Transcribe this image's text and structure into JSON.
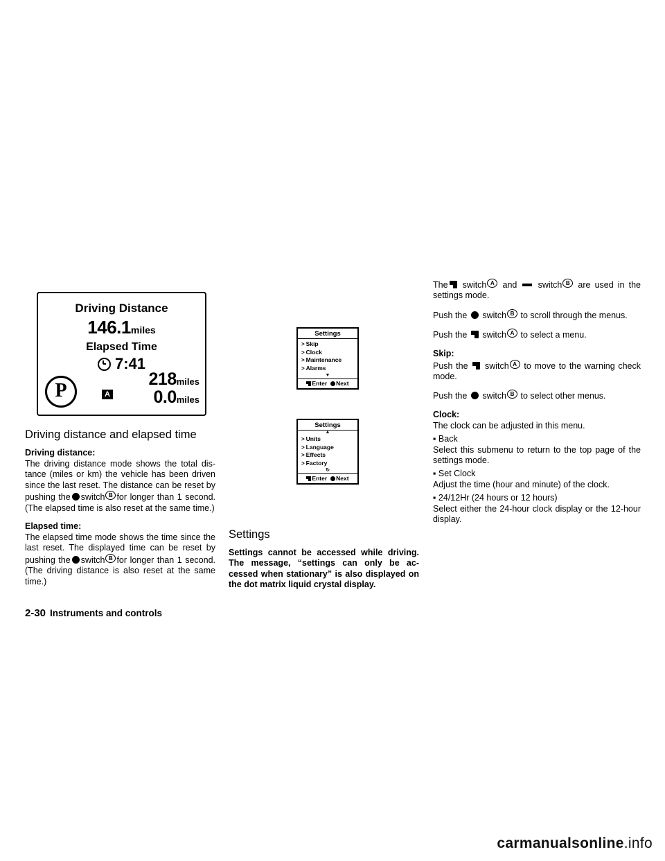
{
  "figure_lcd": {
    "title": "Driving Distance",
    "distance_value": "146.1",
    "distance_unit": "miles",
    "elapsed_label": "Elapsed Time",
    "elapsed_value": "7:41",
    "gear": "P",
    "trip_badge": "A",
    "odometer_value": "218",
    "odometer_unit": "miles",
    "trip_value": "0.0",
    "trip_unit": "miles"
  },
  "col1": {
    "heading": "Driving distance and elapsed time",
    "driving_label": "Driving distance:",
    "driving_text_1": "The driving distance mode shows the total dis-tance (miles or km) the vehicle has been driven since the last reset. The distance can be reset by pushing the",
    "driving_text_2": "switch",
    "driving_text_3": "for longer than 1 second. (The elapsed time is also reset at the same time.)",
    "elapsed_label": "Elapsed time:",
    "elapsed_text_1": "The elapsed time mode shows the time since the last reset. The displayed time can be reset by pushing the",
    "elapsed_text_2": "switch",
    "elapsed_text_3": "for longer than 1 second. (The driving distance is also reset at the same time.)",
    "switch_b": "B"
  },
  "menu1": {
    "title": "Settings",
    "items": [
      "Skip",
      "Clock",
      "Maintenance",
      "Alarms"
    ],
    "enter_label": "Enter",
    "next_label": "Next"
  },
  "menu2": {
    "title": "Settings",
    "items": [
      "Units",
      "Language",
      "Effects",
      "Factory"
    ],
    "enter_label": "Enter",
    "next_label": "Next"
  },
  "col2": {
    "heading": "Settings",
    "warning": "Settings cannot be accessed while driving. The message, “settings can only be ac-cessed when stationary” is also displayed on the dot matrix liquid crystal display."
  },
  "col3": {
    "p1_a": "The",
    "p1_b": "switch",
    "p1_c": "and",
    "p1_d": "switch",
    "p1_e": "are used in the settings mode.",
    "p2_a": "Push the",
    "p2_b": "switch",
    "p2_c": "to scroll through the menus.",
    "p3_a": "Push the",
    "p3_b": "switch",
    "p3_c": "to select a menu.",
    "skip_label": "Skip:",
    "p4_a": "Push the",
    "p4_b": "switch",
    "p4_c": "to move to the warning check mode.",
    "p5_a": "Push the",
    "p5_b": "switch",
    "p5_c": "to select other menus.",
    "clock_label": "Clock:",
    "p6": "The clock can be adjusted in this menu.",
    "bullet1": "Back",
    "bullet1_text": "Select this submenu to return to the top page of the settings mode.",
    "bullet2": "Set Clock",
    "bullet2_text": "Adjust the time (hour and minute) of the clock.",
    "bullet3": "24/12Hr (24 hours or 12 hours)",
    "bullet3_text": "Select either the 24-hour clock display or the 12-hour display.",
    "badge_a": "A",
    "badge_b": "B"
  },
  "footer": {
    "page_number": "2-30",
    "section_title": "Instruments and controls"
  },
  "watermark": {
    "bold_part": "carmanualsonline",
    "rest": ".info"
  }
}
